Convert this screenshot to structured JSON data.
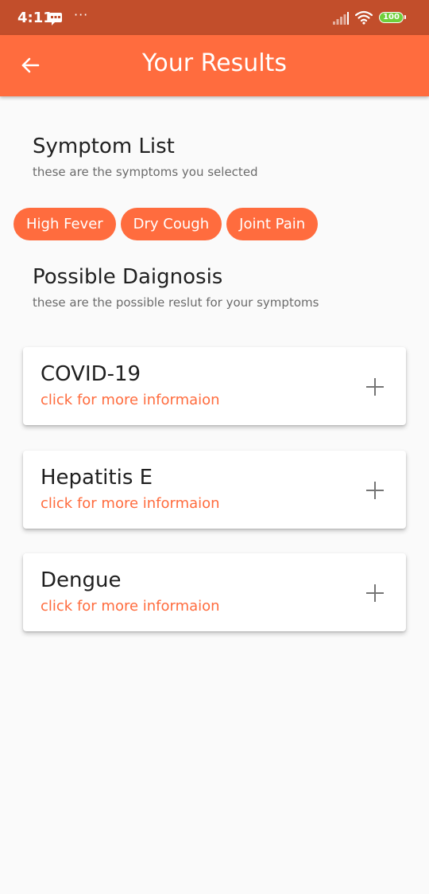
{
  "status_bar": {
    "time": "4:11",
    "more_dots": "···",
    "battery_level": "100",
    "icons": [
      "message-icon",
      "more-icon",
      "signal-icon",
      "wifi-icon",
      "battery-icon"
    ]
  },
  "app_bar": {
    "title": "Your Results",
    "back_icon": "arrow-left-icon",
    "background_color": "#ff6c3e"
  },
  "symptoms": {
    "title": "Symptom List",
    "subtitle": "these are the symptoms you selected",
    "chips": [
      "High Fever",
      "Dry Cough",
      "Joint Pain"
    ]
  },
  "diagnosis": {
    "title": "Possible Daignosis",
    "subtitle": "these are the possible reslut for your symptoms",
    "cards": [
      {
        "title": "COVID-19",
        "subtitle": "click for more informaion",
        "icon": "plus-icon"
      },
      {
        "title": "Hepatitis E",
        "subtitle": "click for more informaion",
        "icon": "plus-icon"
      },
      {
        "title": "Dengue",
        "subtitle": "click for more informaion",
        "icon": "plus-icon"
      }
    ]
  },
  "colors": {
    "accent": "#ff6c3e",
    "status_bar": "#c24e2b",
    "background": "#fafafa"
  }
}
